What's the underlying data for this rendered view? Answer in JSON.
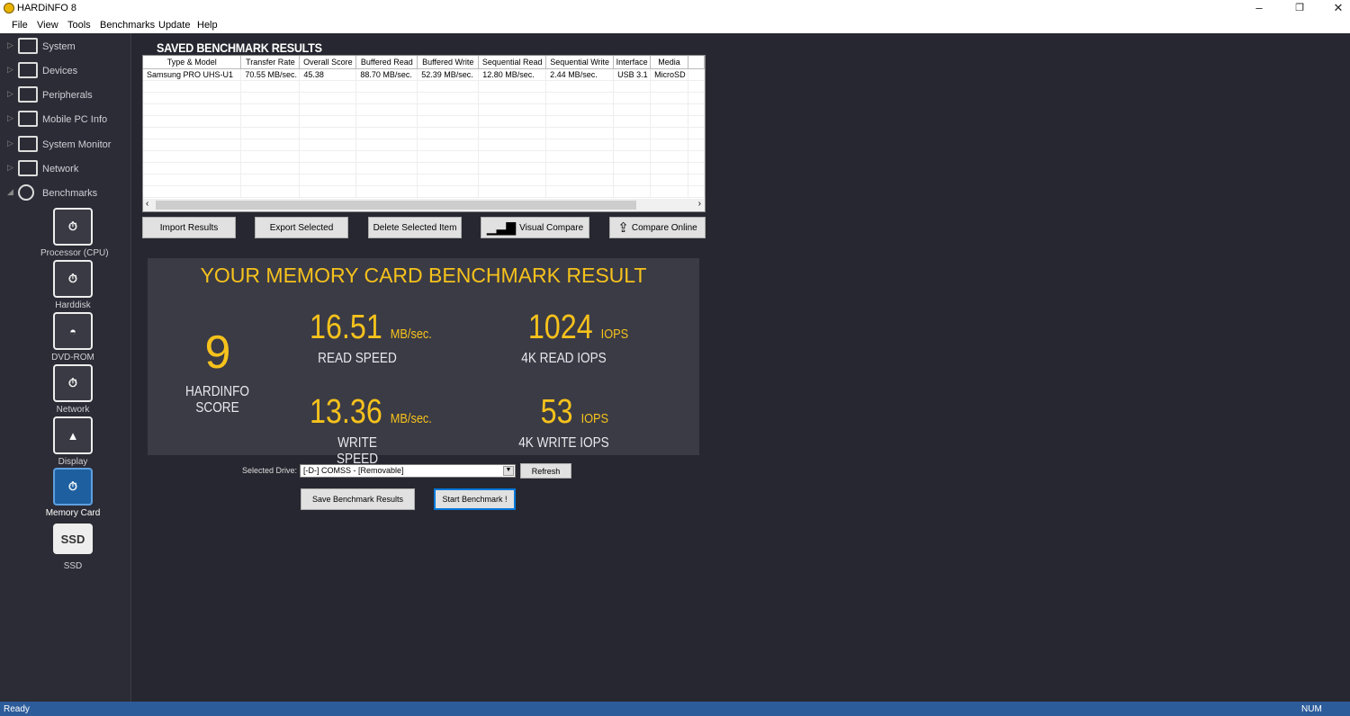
{
  "window": {
    "title": "HARDiNFO 8"
  },
  "menu": [
    "File",
    "View",
    "Tools",
    "Benchmarks",
    "Update",
    "Help"
  ],
  "sidebar": {
    "tree": [
      "System",
      "Devices",
      "Peripherals",
      "Mobile PC Info",
      "System Monitor",
      "Network",
      "Benchmarks"
    ],
    "benchmarks": [
      "Processor (CPU)",
      "Harddisk",
      "DVD-ROM",
      "Network",
      "Display",
      "Memory Card",
      "SSD"
    ],
    "selected": "Memory Card"
  },
  "saved": {
    "title": "SAVED BENCHMARK RESULTS",
    "columns": [
      "Type & Model",
      "Transfer Rate",
      "Overall Score",
      "Buffered Read",
      "Buffered Write",
      "Sequential Read",
      "Sequential Write",
      "Interface",
      "Media"
    ],
    "rows": [
      [
        "Samsung PRO UHS-U1",
        "70.55 MB/sec.",
        "45.38",
        "88.70 MB/sec.",
        "52.39 MB/sec.",
        "12.80 MB/sec.",
        "2.44 MB/sec.",
        "USB 3.1",
        "MicroSD"
      ]
    ],
    "buttons": {
      "import": "Import Results",
      "export": "Export Selected",
      "delete": "Delete Selected Item",
      "visual": "Visual Compare",
      "online": "Compare Online"
    }
  },
  "result": {
    "title": "YOUR MEMORY CARD BENCHMARK RESULT",
    "score": "9",
    "score_label": "HARDINFO SCORE",
    "read": "16.51",
    "read_unit": "MB/sec.",
    "read_label": "READ SPEED",
    "write": "13.36",
    "write_unit": "MB/sec.",
    "write_label": "WRITE SPEED",
    "read_iops": "1024",
    "read_iops_unit": "IOPS",
    "read_iops_label": "4K READ IOPS",
    "write_iops": "53",
    "write_iops_unit": "IOPS",
    "write_iops_label": "4K WRITE IOPS"
  },
  "drive": {
    "label": "Selected Drive:",
    "value": "[-D-] COMSS - [Removable]",
    "refresh": "Refresh"
  },
  "actions": {
    "save": "Save Benchmark Results",
    "start": "Start Benchmark !"
  },
  "status": {
    "left": "Ready",
    "right": "NUM"
  },
  "colors": {
    "accent": "#f6c21c",
    "statusbar": "#2d5c9a",
    "selected": "#1e5fa0"
  }
}
